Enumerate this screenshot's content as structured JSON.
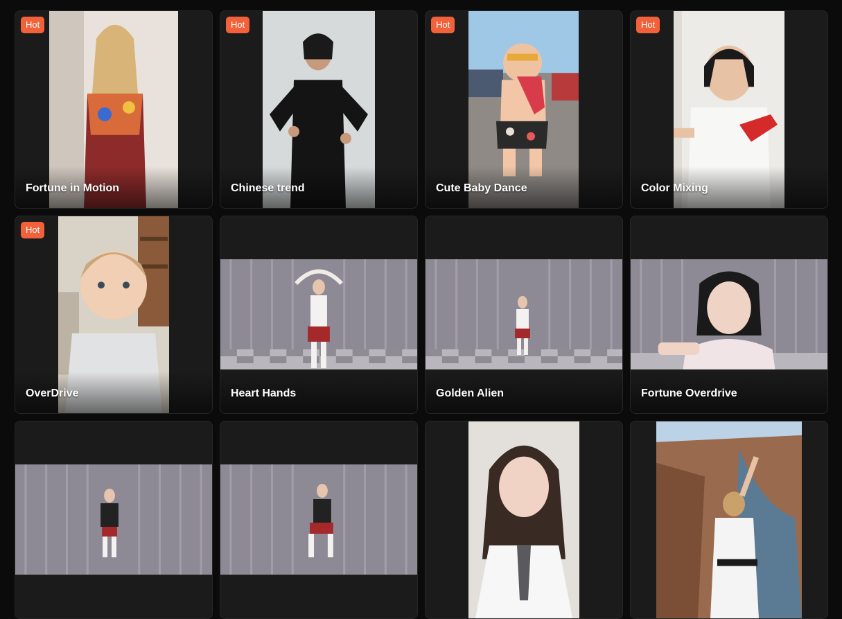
{
  "badge_label": "Hot",
  "cards": [
    {
      "title": "Fortune in Motion",
      "hot": true
    },
    {
      "title": "Chinese trend",
      "hot": true
    },
    {
      "title": "Cute Baby Dance",
      "hot": true
    },
    {
      "title": "Color Mixing",
      "hot": true
    },
    {
      "title": "OverDrive",
      "hot": true
    },
    {
      "title": "Heart Hands",
      "hot": false
    },
    {
      "title": "Golden Alien",
      "hot": false
    },
    {
      "title": "Fortune Overdrive",
      "hot": false
    },
    {
      "title": "",
      "hot": false
    },
    {
      "title": "",
      "hot": false
    },
    {
      "title": "",
      "hot": false
    },
    {
      "title": "",
      "hot": false
    }
  ]
}
